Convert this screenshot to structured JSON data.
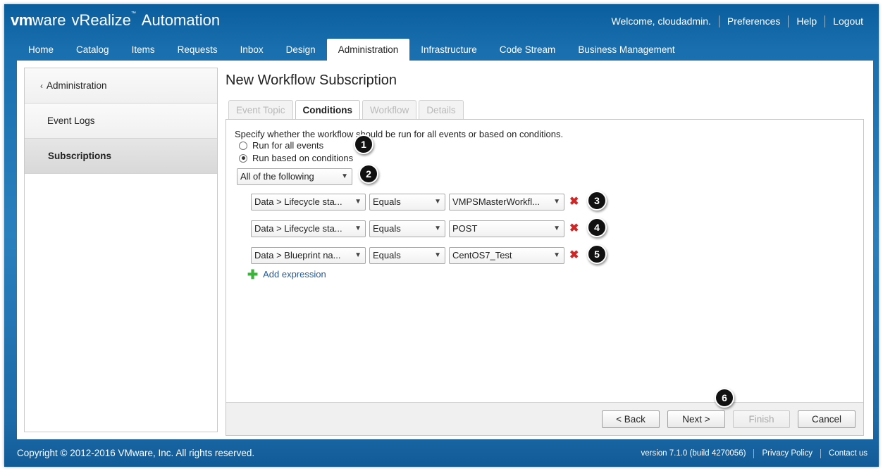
{
  "header": {
    "brand_vm": "vm",
    "brand_ware": "ware",
    "brand_product": "vRealize",
    "brand_product2": "Automation",
    "brand_tm": "™",
    "welcome": "Welcome, cloudadmin.",
    "preferences": "Preferences",
    "help": "Help",
    "logout": "Logout"
  },
  "nav": {
    "tabs": [
      "Home",
      "Catalog",
      "Items",
      "Requests",
      "Inbox",
      "Design",
      "Administration",
      "Infrastructure",
      "Code Stream",
      "Business Management"
    ],
    "active": "Administration"
  },
  "sidebar": {
    "back": "Administration",
    "items": [
      "Event Logs",
      "Subscriptions"
    ],
    "selected": "Subscriptions"
  },
  "page": {
    "title": "New Workflow Subscription",
    "tabs": [
      "Event Topic",
      "Conditions",
      "Workflow",
      "Details"
    ],
    "active_tab": "Conditions"
  },
  "conditions": {
    "instruction": "Specify whether the workflow should be run for all events or based on conditions.",
    "radio_all": "Run for all events",
    "radio_conditions": "Run based on conditions",
    "selected_radio": "Run based on conditions",
    "mode": "All of the following",
    "expressions": [
      {
        "field": "Data > Lifecycle sta...",
        "operator": "Equals",
        "value": "VMPSMasterWorkfl..."
      },
      {
        "field": "Data > Lifecycle sta...",
        "operator": "Equals",
        "value": "POST"
      },
      {
        "field": "Data > Blueprint na...",
        "operator": "Equals",
        "value": "CentOS7_Test"
      }
    ],
    "add_expression": "Add expression"
  },
  "buttons": {
    "back": "< Back",
    "next": "Next >",
    "finish": "Finish",
    "cancel": "Cancel"
  },
  "callouts": [
    "1",
    "2",
    "3",
    "4",
    "5",
    "6"
  ],
  "footer": {
    "copyright": "Copyright © 2012-2016 VMware, Inc. All rights reserved.",
    "version": "version 7.1.0 (build 4270056)",
    "privacy": "Privacy Policy",
    "contact": "Contact us"
  },
  "colors": {
    "header_blue": "#1a6fae",
    "link_blue": "#1f5a9c",
    "remove_red": "#d02626",
    "add_green": "#3bb33b"
  }
}
